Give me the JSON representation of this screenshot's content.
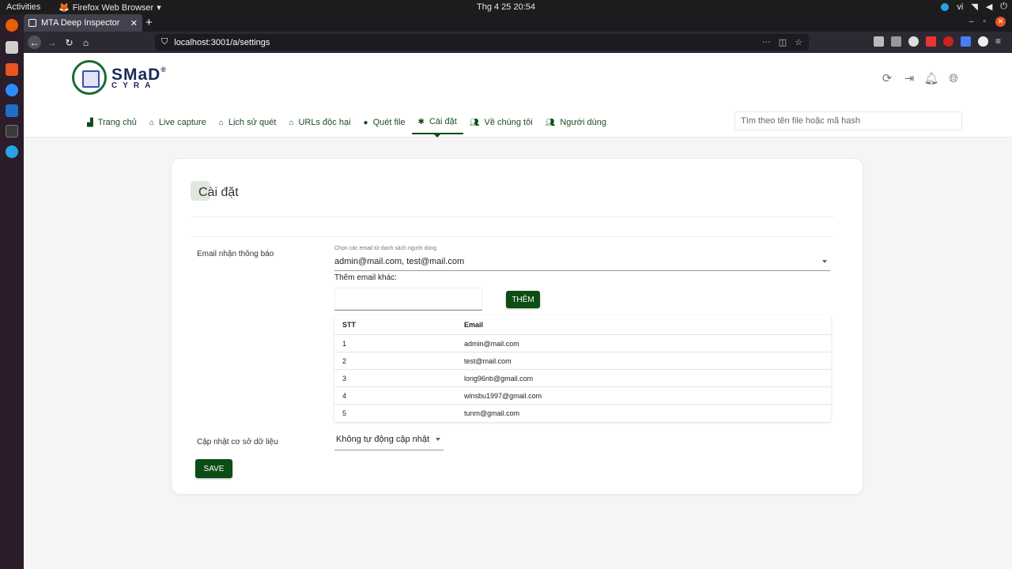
{
  "os": {
    "activities": "Activities",
    "app_name": "Firefox Web Browser",
    "clock": "Thg 4 25  20:54",
    "lang": "vi"
  },
  "browser": {
    "tab_title": "MTA Deep Inspector",
    "url": "localhost:3001/a/settings"
  },
  "app": {
    "logo_main": "SMaD",
    "logo_sub": "CYRA",
    "menu": [
      {
        "label": "Trang chủ",
        "icon": "chart-icon"
      },
      {
        "label": "Live capture",
        "icon": "home-icon"
      },
      {
        "label": "Lịch sử quét",
        "icon": "home-icon"
      },
      {
        "label": "URLs độc hại",
        "icon": "home-icon"
      },
      {
        "label": "Quét file",
        "icon": "shield-icon"
      },
      {
        "label": "Cài đặt",
        "icon": "gear-icon",
        "active": true
      },
      {
        "label": "Về chúng tôi",
        "icon": "users-icon"
      },
      {
        "label": "Người dùng",
        "icon": "group-icon"
      }
    ],
    "search_placeholder": "Tìm theo tên file hoặc mã hash",
    "accent_color": "#0b4d14"
  },
  "settings": {
    "title": "Cài đặt",
    "email_label": "Email nhận thông báo",
    "select_caption": "Chọn các email từ danh sách người dùng",
    "selected_emails": "admin@mail.com, test@mail.com",
    "add_label": "Thêm email khác:",
    "add_button": "THÊM",
    "table": {
      "headers": [
        "STT",
        "Email"
      ],
      "rows": [
        [
          "1",
          "admin@mail.com"
        ],
        [
          "2",
          "test@mail.com"
        ],
        [
          "3",
          "long96nb@gmail.com"
        ],
        [
          "4",
          "winsbu1997@gmail.com"
        ],
        [
          "5",
          "tunm@gmail.com"
        ]
      ]
    },
    "db_label": "Cập nhật cơ sở dữ liệu",
    "db_value": "Không tự động cập nhật",
    "save_button": "SAVE"
  }
}
